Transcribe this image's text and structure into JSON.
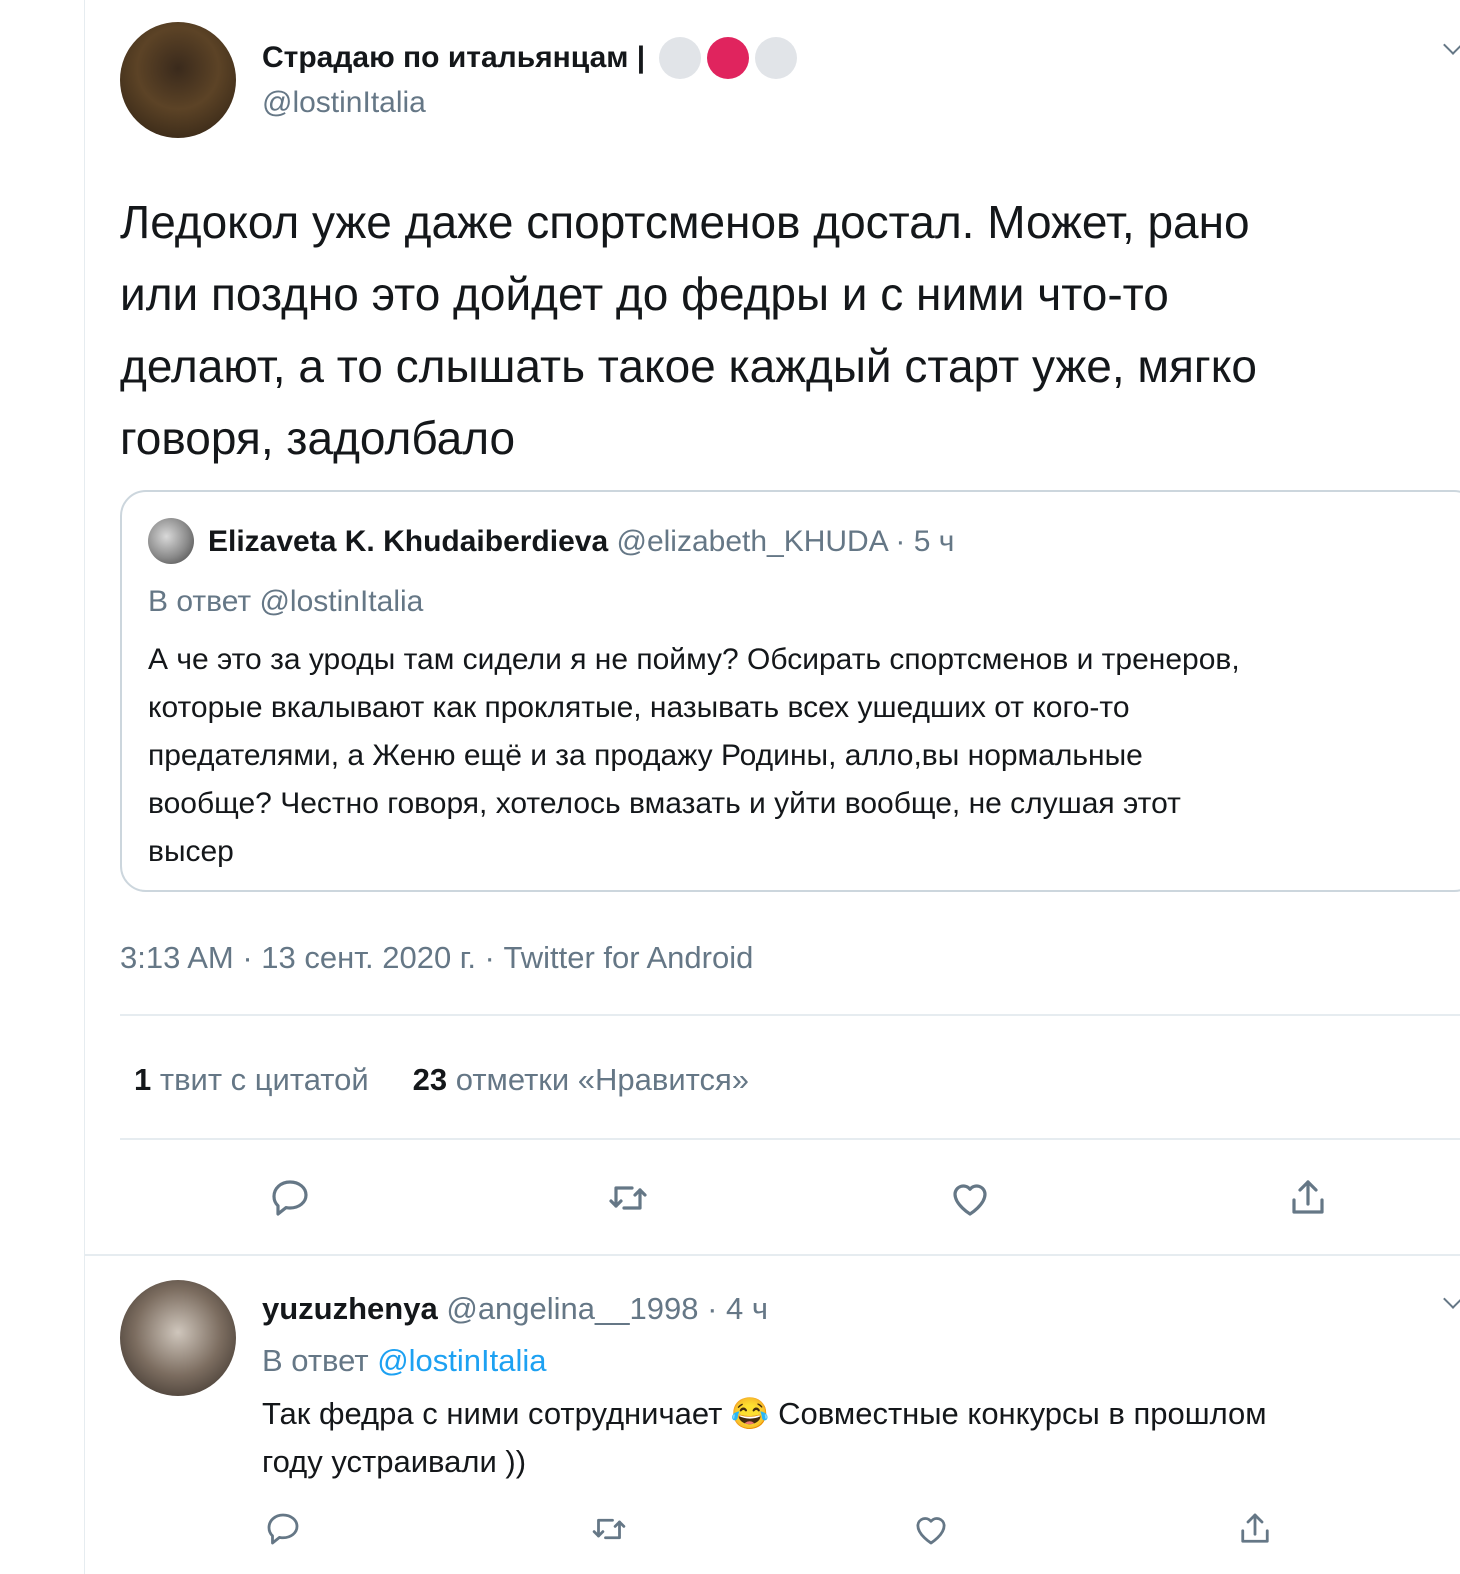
{
  "tweet": {
    "author_name": "Страдаю по итальянцам |",
    "author_handle": "@lostinItalia",
    "badge_colors": [
      "#e1e4e8",
      "#e0245e",
      "#e1e4e8"
    ],
    "text_lines": [
      "Ледокол уже даже спортсменов достал. Может, рано",
      "или поздно это дойдет до федры и с ними что-то",
      "делают, а то слышать такое каждый старт уже, мягко",
      "говоря, задолбало"
    ],
    "meta": "3:13 AM · 13 сент. 2020 г. · Twitter for Android",
    "stats": {
      "quotes_count": "1",
      "quotes_label": "твит с цитатой",
      "likes_count": "23",
      "likes_label": "отметки «Нравится»"
    }
  },
  "quoted": {
    "author_name": "Elizaveta K. Khudaiberdieva",
    "author_handle": "@elizabeth_KHUDA",
    "time": "· 5 ч",
    "reply_to": "В ответ @lostinItalia",
    "text_lines": [
      "А че это за уроды там сидели я не пойму? Обсирать спортсменов и тренеров,",
      "которые вкалывают как проклятые, называть всех ушедших от кого-то",
      "предателями, а Женю ещё и за продажу Родины, алло,вы нормальные",
      "вообще? Честно говоря, хотелось вмазать и уйти вообще, не слушая этот",
      "высер"
    ]
  },
  "reply": {
    "author_name": "yuzuzhenya",
    "author_handle": "@angelina__1998",
    "time": "· 4 ч",
    "reply_prefix": "В ответ",
    "reply_handle": "@lostinItalia",
    "text_line1_a": "Так федра с ними сотрудничает",
    "emoji": "😂",
    "text_line1_b": "Совместные конкурсы в прошлом",
    "text_line2": "году устраивали ))"
  },
  "colors": {
    "accent": "#1da1f2",
    "muted": "#657786",
    "border": "#ccd6dd",
    "divider": "#e6ecf0"
  },
  "icons": [
    "reply-icon",
    "retweet-icon",
    "like-icon",
    "share-icon",
    "chevron-down-icon"
  ]
}
